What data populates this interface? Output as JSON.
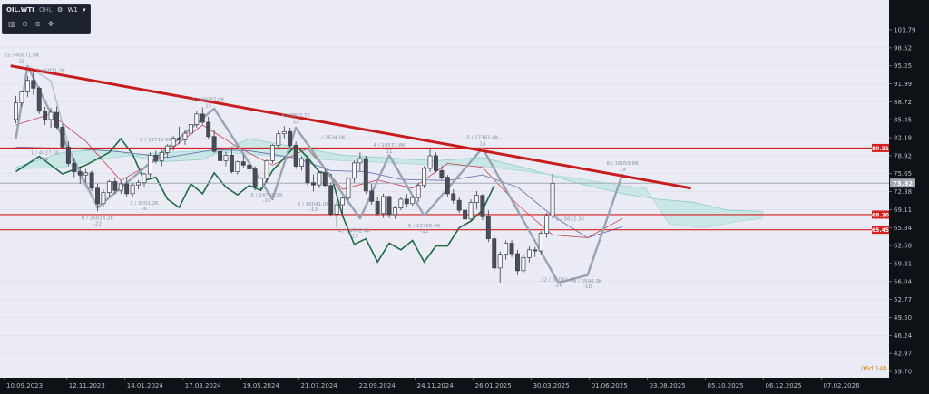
{
  "toolbar": {
    "symbol": "OIL.WTI",
    "source": "OHL",
    "interval": "W1",
    "gear_icon": "gear-icon",
    "dropdown_icon": "chevron-down-icon",
    "tool_icons": [
      "bars-icon",
      "zoom-out-icon",
      "zoom-in-icon",
      "crosshair-icon"
    ]
  },
  "colors": {
    "trendline": "#c81c1c",
    "levels": "#d41e1e",
    "zigzag": "#98a3b4",
    "cloud": "#bfe4e1",
    "price_line": "#a6abb6",
    "chikou": "#1f6b44",
    "kijun": "#6f73b5",
    "tenkan": "#c9434d",
    "countdown": "#e08a14"
  },
  "countdown": "06d 14h",
  "chart_data": {
    "type": "candlestick",
    "symbol": "OIL.WTI",
    "timeframe": "W1",
    "y_ticks": [
      101.79,
      98.52,
      95.25,
      91.99,
      88.72,
      85.45,
      82.18,
      78.92,
      75.65,
      72.38,
      69.11,
      65.84,
      62.58,
      59.31,
      56.04,
      52.77,
      49.5,
      46.24,
      42.97,
      39.7
    ],
    "ylim": [
      39.7,
      101.79
    ],
    "x_ticks": [
      "10.09.2023",
      "12.11.2023",
      "14.01.2024",
      "17.03.2024",
      "19.05.2024",
      "21.07.2024",
      "22.09.2024",
      "24.11.2024",
      "26.01.2025",
      "30.03.2025",
      "01.06.2025",
      "03.08.2025",
      "05.10.2025",
      "06.12.2025",
      "07.02.2026"
    ],
    "current_price": 73.92,
    "horizontal_levels": [
      80.31,
      68.2,
      65.45
    ],
    "trendline": {
      "from": [
        "10.09.2023",
        95.25
      ],
      "to": [
        "03.08.2025",
        73.0
      ]
    },
    "swing_labels": [
      {
        "text": "15 / 40871.8K",
        "x": 1,
        "y": 95.25,
        "pos": "above",
        "sub": "25"
      },
      {
        "text": "2 / 6851.2K",
        "x": 6,
        "y": 92.5,
        "pos": "above",
        "sub": ""
      },
      {
        "text": "1 / 4427.0K",
        "x": 5,
        "y": 77.5,
        "pos": "above",
        "sub": "14"
      },
      {
        "text": "8 / 26024.2K",
        "x": 14,
        "y": 68.8,
        "pos": "below",
        "sub": "-22"
      },
      {
        "text": "1 / 3201.2K",
        "x": 22,
        "y": 71.5,
        "pos": "below",
        "sub": "-6"
      },
      {
        "text": "2 / 32715.6K",
        "x": 24,
        "y": 79.9,
        "pos": "above",
        "sub": ""
      },
      {
        "text": "1 / 46097.8K",
        "x": 33,
        "y": 87.2,
        "pos": "above",
        "sub": "15"
      },
      {
        "text": "5 / 24738.0K",
        "x": 43,
        "y": 73.0,
        "pos": "below",
        "sub": "-15"
      },
      {
        "text": "4 / 8883.7K",
        "x": 48,
        "y": 84.3,
        "pos": "above",
        "sub": "12"
      },
      {
        "text": "1 / 2624.0K",
        "x": 54,
        "y": 80.3,
        "pos": "above",
        "sub": ""
      },
      {
        "text": "5 / 10041.0K",
        "x": 51,
        "y": 71.3,
        "pos": "below",
        "sub": "-13"
      },
      {
        "text": "4 / 14702.4K",
        "x": 58,
        "y": 66.5,
        "pos": "below",
        "sub": "-15"
      },
      {
        "text": "4 / 19577.8K",
        "x": 64,
        "y": 78.9,
        "pos": "above",
        "sub": "11"
      },
      {
        "text": "5 / 10755.0K",
        "x": 70,
        "y": 67.4,
        "pos": "below",
        "sub": "-12"
      },
      {
        "text": "5 / 17361.6K",
        "x": 80,
        "y": 80.3,
        "pos": "above",
        "sub": "14"
      },
      {
        "text": "2 / 5832.3K",
        "x": 95,
        "y": 65.5,
        "pos": "above",
        "sub": ""
      },
      {
        "text": "12 / 35021.6K",
        "x": 93,
        "y": 57.6,
        "pos": "below",
        "sub": "-26"
      },
      {
        "text": "5 / 5598.3K",
        "x": 98,
        "y": 57.3,
        "pos": "below",
        "sub": "-10"
      },
      {
        "text": "8 / 16059.8K",
        "x": 104,
        "y": 75.6,
        "pos": "above",
        "sub": "19"
      }
    ],
    "zigzag_dark": [
      [
        0,
        82
      ],
      [
        2,
        95.2
      ],
      [
        14,
        69.5
      ],
      [
        34,
        87.5
      ],
      [
        44,
        71
      ],
      [
        48,
        84
      ],
      [
        59,
        67.5
      ],
      [
        64,
        79
      ],
      [
        70,
        68
      ],
      [
        80,
        80.3
      ],
      [
        93,
        55.8
      ],
      [
        98,
        57.2
      ],
      [
        104,
        75.6
      ]
    ],
    "zigzag_light": [
      [
        2,
        95.2
      ],
      [
        6,
        92.5
      ],
      [
        10,
        77
      ],
      [
        14,
        69.5
      ]
    ],
    "candles": [
      [
        85.5,
        89.8,
        84.8,
        88.5
      ],
      [
        88.5,
        90.7,
        87.8,
        90.5
      ],
      [
        90.5,
        93.4,
        89.6,
        92.6
      ],
      [
        92.6,
        94.8,
        90.0,
        91.2
      ],
      [
        91.2,
        91.5,
        86.5,
        87.0
      ],
      [
        87.0,
        87.8,
        84.5,
        85.5
      ],
      [
        85.5,
        87.6,
        84.0,
        86.8
      ],
      [
        86.8,
        87.9,
        83.8,
        84.1
      ],
      [
        84.1,
        84.8,
        80.0,
        80.5
      ],
      [
        80.5,
        81.5,
        77.0,
        77.5
      ],
      [
        77.5,
        78.5,
        75.0,
        76.0
      ],
      [
        76.0,
        77.0,
        73.8,
        75.4
      ],
      [
        75.4,
        76.5,
        74.0,
        75.8
      ],
      [
        75.8,
        76.2,
        72.5,
        73.0
      ],
      [
        73.0,
        73.8,
        68.8,
        70.2
      ],
      [
        70.2,
        72.8,
        69.6,
        72.2
      ],
      [
        72.2,
        74.5,
        71.5,
        74.2
      ],
      [
        74.2,
        75.0,
        71.9,
        72.6
      ],
      [
        72.6,
        74.4,
        72.0,
        73.8
      ],
      [
        73.8,
        75.0,
        71.5,
        72.0
      ],
      [
        72.0,
        74.0,
        71.3,
        73.6
      ],
      [
        73.6,
        74.5,
        72.8,
        74.0
      ],
      [
        74.0,
        75.8,
        73.2,
        75.6
      ],
      [
        75.6,
        79.5,
        75.0,
        79.0
      ],
      [
        79.0,
        79.8,
        77.5,
        78.0
      ],
      [
        78.0,
        80.0,
        77.0,
        79.5
      ],
      [
        79.5,
        81.0,
        78.6,
        80.7
      ],
      [
        80.7,
        82.5,
        79.8,
        82.1
      ],
      [
        82.1,
        84.2,
        81.0,
        81.8
      ],
      [
        81.8,
        83.6,
        80.9,
        83.0
      ],
      [
        83.0,
        85.0,
        82.5,
        84.6
      ],
      [
        84.6,
        87.0,
        84.0,
        86.5
      ],
      [
        86.5,
        87.7,
        84.6,
        85.0
      ],
      [
        85.0,
        86.0,
        82.0,
        82.4
      ],
      [
        82.4,
        83.5,
        79.4,
        79.7
      ],
      [
        79.7,
        80.5,
        77.2,
        78.0
      ],
      [
        78.0,
        79.6,
        77.0,
        79.0
      ],
      [
        79.0,
        80.0,
        75.7,
        76.0
      ],
      [
        76.0,
        78.0,
        75.5,
        77.8
      ],
      [
        77.8,
        79.0,
        76.7,
        77.2
      ],
      [
        77.2,
        78.3,
        75.8,
        76.5
      ],
      [
        76.5,
        77.0,
        72.6,
        73.2
      ],
      [
        73.2,
        75.0,
        72.8,
        74.8
      ],
      [
        74.8,
        78.3,
        74.0,
        78.0
      ],
      [
        78.0,
        81.0,
        77.5,
        80.8
      ],
      [
        80.8,
        83.4,
        80.0,
        82.9
      ],
      [
        82.9,
        84.3,
        82.1,
        83.3
      ],
      [
        83.3,
        84.0,
        80.3,
        80.8
      ],
      [
        80.8,
        81.5,
        76.5,
        77.0
      ],
      [
        77.0,
        78.8,
        76.2,
        78.4
      ],
      [
        78.4,
        79.0,
        73.5,
        74.0
      ],
      [
        74.0,
        75.5,
        72.4,
        73.6
      ],
      [
        73.6,
        76.0,
        73.0,
        75.8
      ],
      [
        75.8,
        76.5,
        73.2,
        73.5
      ],
      [
        73.5,
        74.0,
        67.8,
        68.3
      ],
      [
        68.3,
        70.6,
        65.8,
        70.0
      ],
      [
        70.0,
        71.5,
        67.7,
        71.2
      ],
      [
        71.2,
        75.0,
        70.8,
        74.8
      ],
      [
        74.8,
        78.0,
        74.0,
        77.6
      ],
      [
        77.6,
        79.5,
        76.1,
        78.4
      ],
      [
        78.4,
        78.9,
        72.0,
        72.5
      ],
      [
        72.5,
        73.8,
        70.0,
        70.6
      ],
      [
        70.6,
        71.5,
        68.0,
        68.4
      ],
      [
        68.4,
        72.0,
        67.6,
        71.5
      ],
      [
        71.5,
        71.7,
        67.6,
        68.2
      ],
      [
        68.2,
        69.8,
        67.4,
        69.4
      ],
      [
        69.4,
        71.4,
        69.0,
        71.0
      ],
      [
        71.0,
        72.0,
        69.6,
        70.2
      ],
      [
        70.2,
        71.6,
        69.8,
        71.3
      ],
      [
        71.3,
        74.0,
        70.5,
        73.5
      ],
      [
        73.5,
        77.0,
        73.0,
        76.6
      ],
      [
        76.6,
        80.3,
        76.0,
        78.9
      ],
      [
        78.9,
        79.5,
        75.8,
        76.2
      ],
      [
        76.2,
        77.0,
        74.5,
        75.0
      ],
      [
        75.0,
        75.4,
        71.4,
        72.0
      ],
      [
        72.0,
        72.8,
        70.2,
        70.8
      ],
      [
        70.8,
        71.4,
        68.5,
        69.0
      ],
      [
        69.0,
        69.4,
        66.8,
        67.4
      ],
      [
        67.4,
        71.0,
        66.9,
        70.4
      ],
      [
        70.4,
        72.5,
        69.2,
        71.7
      ],
      [
        71.7,
        71.9,
        67.2,
        67.8
      ],
      [
        67.8,
        69.0,
        63.2,
        63.8
      ],
      [
        63.8,
        64.8,
        57.6,
        58.5
      ],
      [
        58.5,
        61.5,
        55.8,
        61.0
      ],
      [
        61.0,
        63.5,
        60.0,
        63.0
      ],
      [
        63.0,
        63.6,
        60.5,
        61.1
      ],
      [
        61.1,
        61.8,
        57.2,
        58.0
      ],
      [
        58.0,
        61.0,
        57.6,
        60.4
      ],
      [
        60.4,
        62.4,
        59.5,
        61.8
      ],
      [
        61.8,
        62.3,
        60.5,
        61.6
      ],
      [
        61.6,
        65.2,
        61.0,
        64.8
      ],
      [
        64.8,
        68.5,
        64.0,
        68.0
      ],
      [
        68.0,
        75.6,
        67.5,
        73.9
      ]
    ],
    "candle_offset": 0,
    "ichimoku": {
      "span_a": [
        [
          0,
          76.8
        ],
        [
          8,
          79.5
        ],
        [
          16,
          80.2
        ],
        [
          24,
          77.8
        ],
        [
          32,
          78.2
        ],
        [
          40,
          82.0
        ],
        [
          48,
          80.5
        ],
        [
          56,
          79.0
        ],
        [
          64,
          78.5
        ],
        [
          72,
          78.0
        ],
        [
          80,
          78.6
        ],
        [
          88,
          76.5
        ],
        [
          96,
          74.0
        ],
        [
          104,
          72.0
        ],
        [
          110,
          71.0
        ],
        [
          116,
          70.5
        ],
        [
          122,
          69.0
        ],
        [
          128,
          68.8
        ]
      ],
      "span_b": [
        [
          0,
          76.5
        ],
        [
          8,
          76.8
        ],
        [
          16,
          78.5
        ],
        [
          24,
          79.4
        ],
        [
          32,
          79.8
        ],
        [
          40,
          79.2
        ],
        [
          48,
          78.5
        ],
        [
          56,
          78.0
        ],
        [
          64,
          77.6
        ],
        [
          72,
          77.2
        ],
        [
          80,
          77.0
        ],
        [
          88,
          76.0
        ],
        [
          96,
          74.8
        ],
        [
          104,
          73.5
        ],
        [
          108,
          73.0
        ],
        [
          112,
          66.5
        ],
        [
          118,
          65.8
        ],
        [
          124,
          67.0
        ],
        [
          128,
          67.5
        ]
      ],
      "kijun": [
        [
          0,
          80.5
        ],
        [
          10,
          80.2
        ],
        [
          18,
          79.6
        ],
        [
          26,
          78.6
        ],
        [
          34,
          80.0
        ],
        [
          40,
          79.8
        ],
        [
          48,
          78.5
        ],
        [
          54,
          76.2
        ],
        [
          60,
          76.0
        ],
        [
          66,
          74.6
        ],
        [
          74,
          74.4
        ],
        [
          80,
          75.4
        ],
        [
          86,
          73.2
        ],
        [
          92,
          68.0
        ],
        [
          98,
          64.0
        ],
        [
          104,
          66.0
        ]
      ],
      "tenkan": [
        [
          0,
          84.5
        ],
        [
          6,
          86.5
        ],
        [
          12,
          81.5
        ],
        [
          18,
          74.4
        ],
        [
          24,
          78.0
        ],
        [
          32,
          84.5
        ],
        [
          38,
          80.5
        ],
        [
          44,
          77.2
        ],
        [
          50,
          80.2
        ],
        [
          56,
          72.8
        ],
        [
          62,
          74.5
        ],
        [
          68,
          73.0
        ],
        [
          74,
          77.5
        ],
        [
          80,
          76.8
        ],
        [
          86,
          70.0
        ],
        [
          92,
          64.5
        ],
        [
          98,
          64.0
        ],
        [
          104,
          67.5
        ]
      ],
      "chikou": [
        [
          0,
          76.0
        ],
        [
          4,
          78.8
        ],
        [
          8,
          75.6
        ],
        [
          12,
          77.2
        ],
        [
          16,
          79.5
        ],
        [
          18,
          82.0
        ],
        [
          20,
          79.2
        ],
        [
          22,
          74.4
        ],
        [
          24,
          75.0
        ],
        [
          26,
          71.0
        ],
        [
          28,
          69.5
        ],
        [
          30,
          73.8
        ],
        [
          32,
          72.0
        ],
        [
          34,
          75.8
        ],
        [
          36,
          73.2
        ],
        [
          38,
          71.8
        ],
        [
          40,
          73.5
        ],
        [
          42,
          72.6
        ],
        [
          44,
          76.2
        ],
        [
          46,
          78.5
        ],
        [
          48,
          80.8
        ],
        [
          50,
          78.6
        ],
        [
          52,
          76.0
        ],
        [
          54,
          75.5
        ],
        [
          56,
          68.0
        ],
        [
          58,
          62.8
        ],
        [
          60,
          63.8
        ],
        [
          62,
          59.6
        ],
        [
          64,
          63.0
        ],
        [
          66,
          61.8
        ],
        [
          68,
          63.5
        ],
        [
          70,
          59.6
        ],
        [
          72,
          62.5
        ],
        [
          74,
          62.5
        ],
        [
          76,
          65.8
        ],
        [
          78,
          67.0
        ],
        [
          80,
          69.0
        ],
        [
          82,
          73.5
        ]
      ]
    }
  }
}
